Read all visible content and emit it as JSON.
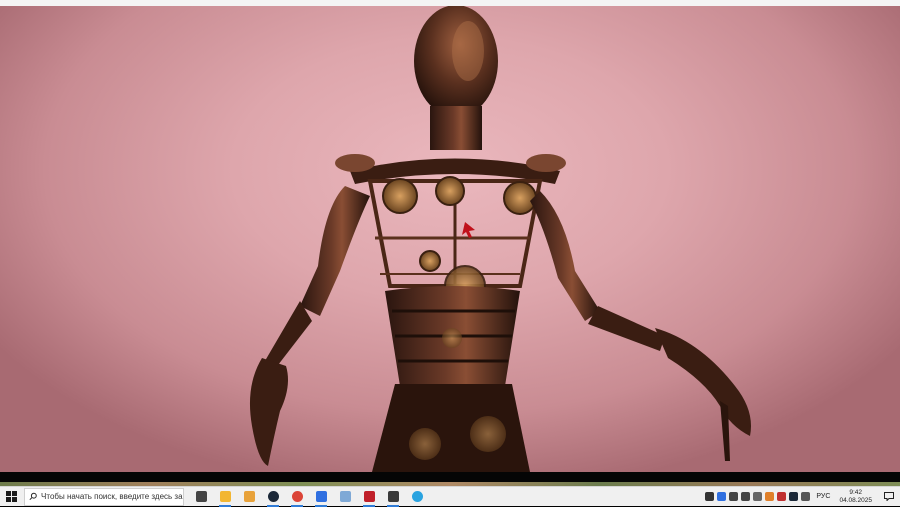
{
  "taskbar": {
    "search_placeholder": "Чтобы начать поиск, введите здесь запрос",
    "apps": [
      {
        "name": "task-view-icon",
        "color": "#444444",
        "running": false
      },
      {
        "name": "file-explorer-icon",
        "color": "#f2b632",
        "running": true
      },
      {
        "name": "photos-icon",
        "color": "#e8a23a",
        "running": false
      },
      {
        "name": "steam-icon",
        "color": "#1b2838",
        "running": true
      },
      {
        "name": "chrome-icon",
        "color": "#db4437",
        "running": true
      },
      {
        "name": "blue-square-app-icon",
        "color": "#2f6fe0",
        "running": true
      },
      {
        "name": "notes-app-icon",
        "color": "#7fa9d6",
        "running": false
      },
      {
        "name": "red-game-icon",
        "color": "#c0202a",
        "running": true
      },
      {
        "name": "game-window-icon",
        "color": "#3a3a3a",
        "running": true
      },
      {
        "name": "telegram-icon",
        "color": "#2aa3e0",
        "running": false
      }
    ],
    "tray": {
      "icons": [
        {
          "name": "tray-app-1-icon",
          "color": "#333333"
        },
        {
          "name": "tray-app-2-icon",
          "color": "#2f6fe0"
        },
        {
          "name": "volume-icon",
          "color": "#444444"
        },
        {
          "name": "network-icon",
          "color": "#444444"
        },
        {
          "name": "tray-app-3-icon",
          "color": "#666666"
        },
        {
          "name": "tray-app-4-icon",
          "color": "#e0802a"
        },
        {
          "name": "security-icon",
          "color": "#c03030"
        },
        {
          "name": "steam-tray-icon",
          "color": "#1b2838"
        },
        {
          "name": "display-icon",
          "color": "#555555"
        }
      ],
      "language": "РУС",
      "time": "9:42",
      "date": "04.08.2025"
    }
  },
  "viewport": {
    "background_color": "#e3adb3",
    "figure": "steampunk-robot"
  }
}
